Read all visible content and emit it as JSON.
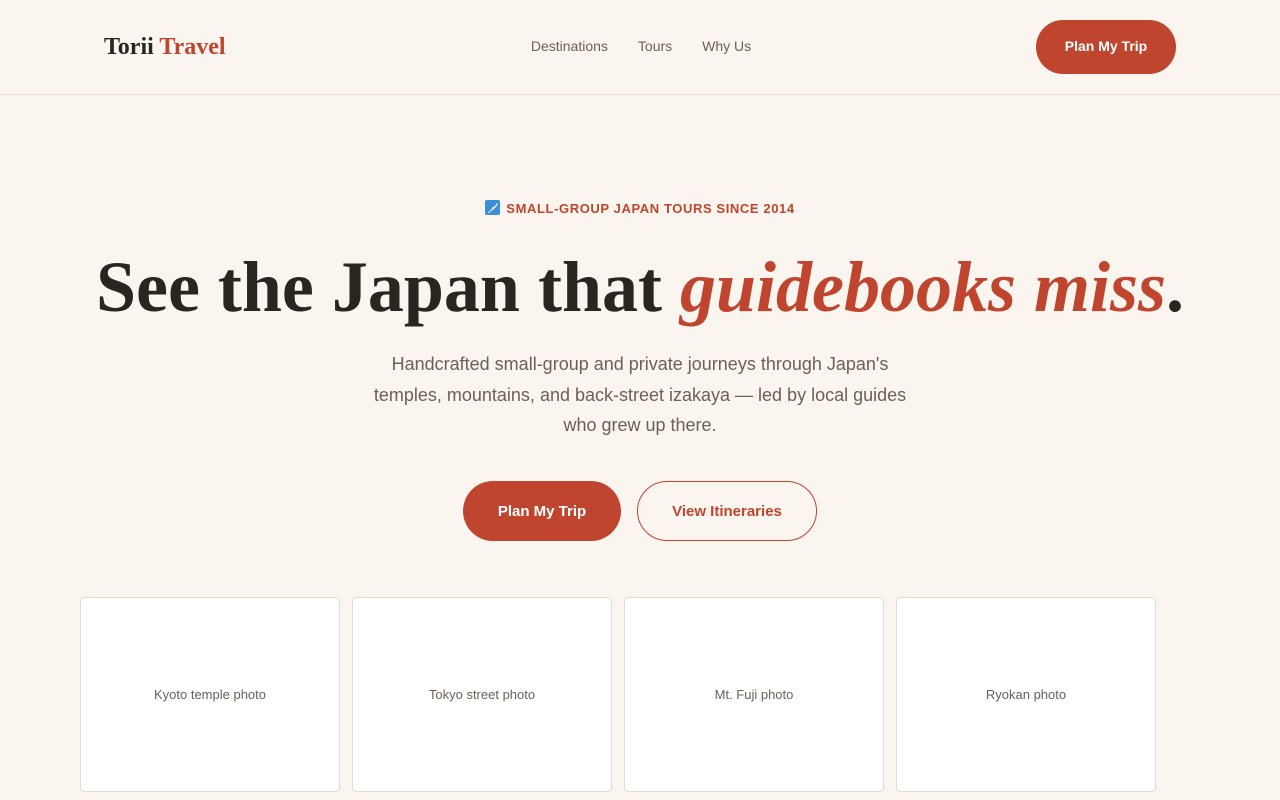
{
  "brand": {
    "name_part1": "Torii",
    "name_part2": "Travel"
  },
  "nav": {
    "items": [
      {
        "label": "Destinations"
      },
      {
        "label": "Tours"
      },
      {
        "label": "Why Us"
      }
    ]
  },
  "header": {
    "cta_label": "Plan My Trip"
  },
  "hero": {
    "eyebrow_icon": "japan-map-icon",
    "eyebrow": "SMALL-GROUP JAPAN TOURS SINCE 2014",
    "headline_start": "See the Japan that ",
    "headline_emphasis": "guidebooks miss",
    "headline_end": ".",
    "subtext": "Handcrafted small-group and private journeys through Japan's temples, mountains, and back-street izakaya — led by local guides who grew up there.",
    "primary_cta": "Plan My Trip",
    "secondary_cta": "View Itineraries"
  },
  "photos": [
    {
      "label": "Kyoto temple photo"
    },
    {
      "label": "Tokyo street photo"
    },
    {
      "label": "Mt. Fuji photo"
    },
    {
      "label": "Ryokan photo"
    }
  ],
  "colors": {
    "accent": "#c0452f",
    "background": "#faf5ee",
    "text": "#2a2520",
    "muted": "#6b6156",
    "border": "#e8dcc8"
  }
}
